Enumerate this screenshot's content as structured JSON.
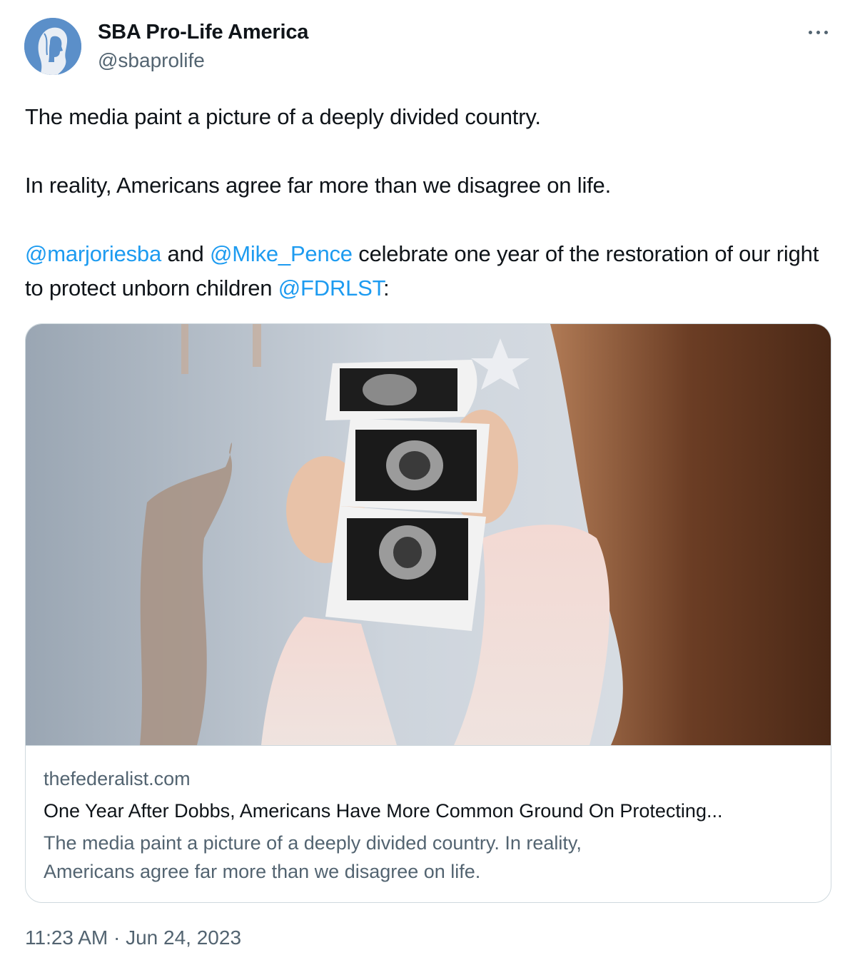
{
  "author": {
    "display_name": "SBA Pro-Life America",
    "handle": "@sbaprolife",
    "avatar_icon": "woman-profile-silhouette-icon",
    "avatar_color": "#5b8fc9"
  },
  "more_icon": "more-horizontal-icon",
  "tweet": {
    "line1": "The media paint a picture of a deeply divided country.",
    "line2": "In reality, Americans agree far more than we disagree on life.",
    "mention1": "@marjoriesba",
    "and_text": " and ",
    "mention2": "@Mike_Pence",
    "text3": " celebrate one year of the restoration of our right to protect unborn children ",
    "mention3": "@FDRLST",
    "text3_end": ":"
  },
  "link_card": {
    "image_subject": "woman-holding-ultrasound-photos",
    "domain": "thefederalist.com",
    "title": "One Year After Dobbs, Americans Have More Common Ground On Protecting...",
    "description": "The media paint a picture of a deeply divided country. In reality, Americans agree far more than we disagree on life."
  },
  "timestamp": "11:23 AM · Jun 24, 2023",
  "colors": {
    "link": "#1d9bf0",
    "secondary_text": "#536471",
    "border": "#cfd9de"
  }
}
